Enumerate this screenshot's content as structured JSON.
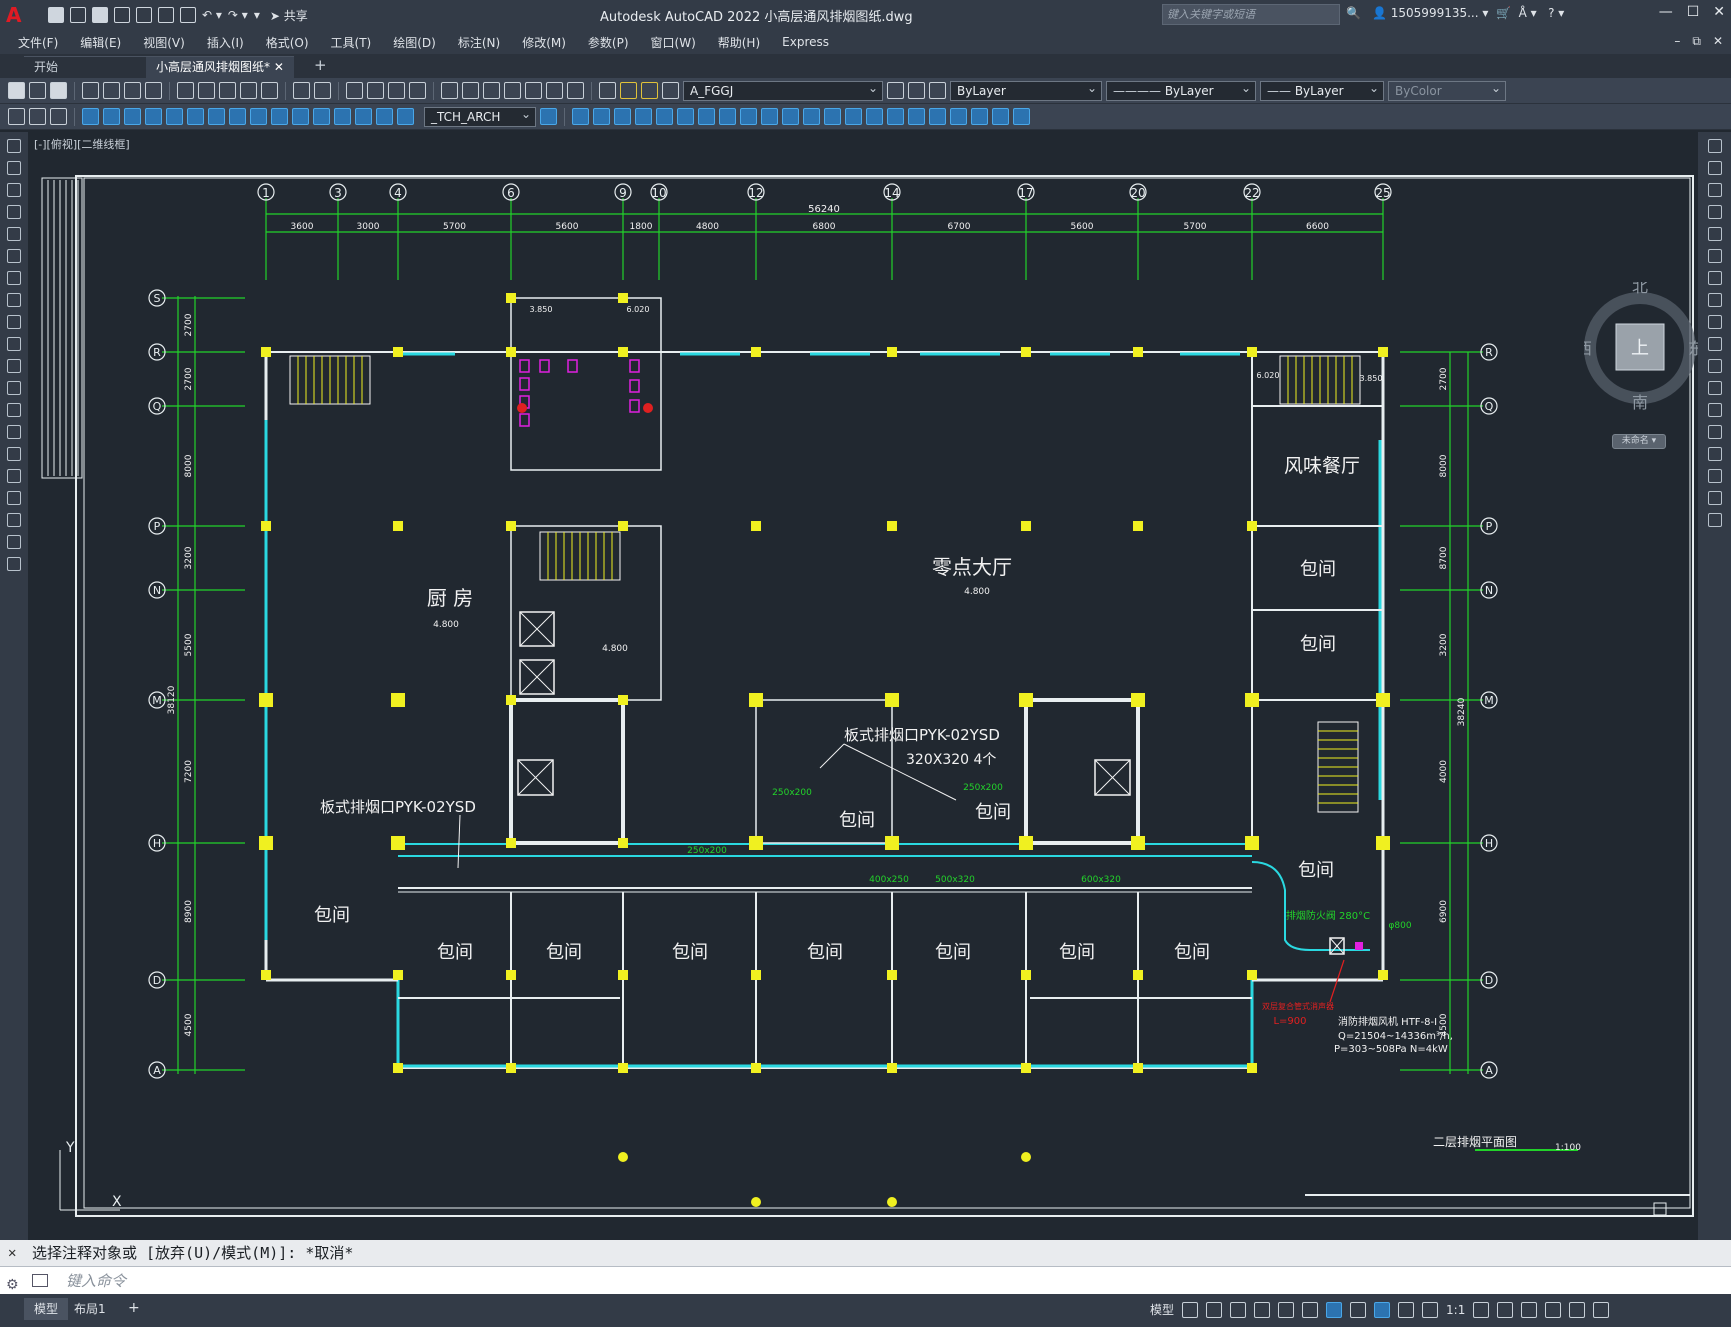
{
  "window": {
    "title": "Autodesk AutoCAD 2022    小高层通风排烟图纸.dwg",
    "search_placeholder": "键入关键字或短语",
    "user": "1505999135... ▾",
    "share": "共享"
  },
  "menus": [
    "文件(F)",
    "编辑(E)",
    "视图(V)",
    "插入(I)",
    "格式(O)",
    "工具(T)",
    "绘图(D)",
    "标注(N)",
    "修改(M)",
    "参数(P)",
    "窗口(W)",
    "帮助(H)",
    "Express"
  ],
  "tabs": [
    {
      "label": "开始",
      "active": false
    },
    {
      "label": "小高层通风排烟图纸*",
      "active": true
    }
  ],
  "toolbar": {
    "layer": "A_FGGJ",
    "color": "ByLayer",
    "linetype": "ByLayer",
    "lineweight": "ByLayer",
    "plotstyle": "ByColor",
    "textstyle": "_TCH_ARCH"
  },
  "viewport": {
    "label": "[-][俯视][二维线框]"
  },
  "viewcube": {
    "north": "北",
    "south": "南",
    "east": "东",
    "west": "西",
    "top": "上",
    "wcs": "未命名 ▾"
  },
  "drawing": {
    "colors": {
      "axis": "#22d32a",
      "column": "#f0f020",
      "wall": "#e8eef0",
      "window": "#2ad8e0",
      "text": "#f2f2f2",
      "fixture": "#e020e0",
      "red": "#e02020"
    },
    "col_axis_labels": [
      "1",
      "3",
      "4",
      "6",
      "9",
      "10",
      "12",
      "14",
      "17",
      "20",
      "22",
      "25"
    ],
    "col_dims": [
      "3600",
      "3000",
      "5700",
      "5600",
      "1800",
      "4800",
      "6800",
      "6700",
      "5600",
      "5700",
      "6600"
    ],
    "total_dim": "56240",
    "row_axis_labels": [
      "S",
      "R",
      "Q",
      "P",
      "N",
      "M",
      "H",
      "D",
      "A"
    ],
    "left_dims": [
      "2700",
      "2700",
      "8000",
      "3200",
      "5500",
      "7200",
      "8900",
      "4500"
    ],
    "left_total": "38120",
    "right_dims": [
      "2700",
      "8000",
      "8700",
      "3200",
      "4000",
      "6900",
      "4500"
    ],
    "right_total": "38240",
    "rooms": [
      {
        "label": "厨 房",
        "big": true
      },
      {
        "label": "零点大厅",
        "big": true
      },
      {
        "label": "风味餐厅",
        "big": true
      },
      {
        "label": "包间"
      }
    ],
    "elevations": [
      "4.800",
      "4.800",
      "4.800"
    ],
    "notes": {
      "vent1": "板式排烟口PYK-02YSD",
      "vent2": "板式排烟口PYK-02YSD",
      "vent2_size": "320X320  4个",
      "duct1": "250x200",
      "duct2": "250x200",
      "duct3": "250x200",
      "duct4": "400x250",
      "duct5": "500x320",
      "duct6": "600x320",
      "damper": "排烟防火阀 280°C",
      "d800": "φ800",
      "fan_title": "消防排烟风机 HTF-8-I",
      "fan_q": "Q=21504~14336m³/h,",
      "fan_p": "P=303~508Pa N=4kW",
      "silencer": "双层复合管式消声器",
      "silencer_l": "L=900",
      "stair_lvl1": "3.850",
      "stair_lvl2": "6.020",
      "stair_lvl3": "3.850",
      "stair_lvl4": "6.020",
      "plan_title": "二层排烟平面图",
      "scale": "1:100"
    }
  },
  "command": {
    "history": "选择注释对象或 [放弃(U)/模式(M)]: *取消*",
    "placeholder": "键入命令"
  },
  "status": {
    "layouts": [
      "模型",
      "布局1"
    ],
    "model": "模型",
    "scale": "1:1"
  }
}
